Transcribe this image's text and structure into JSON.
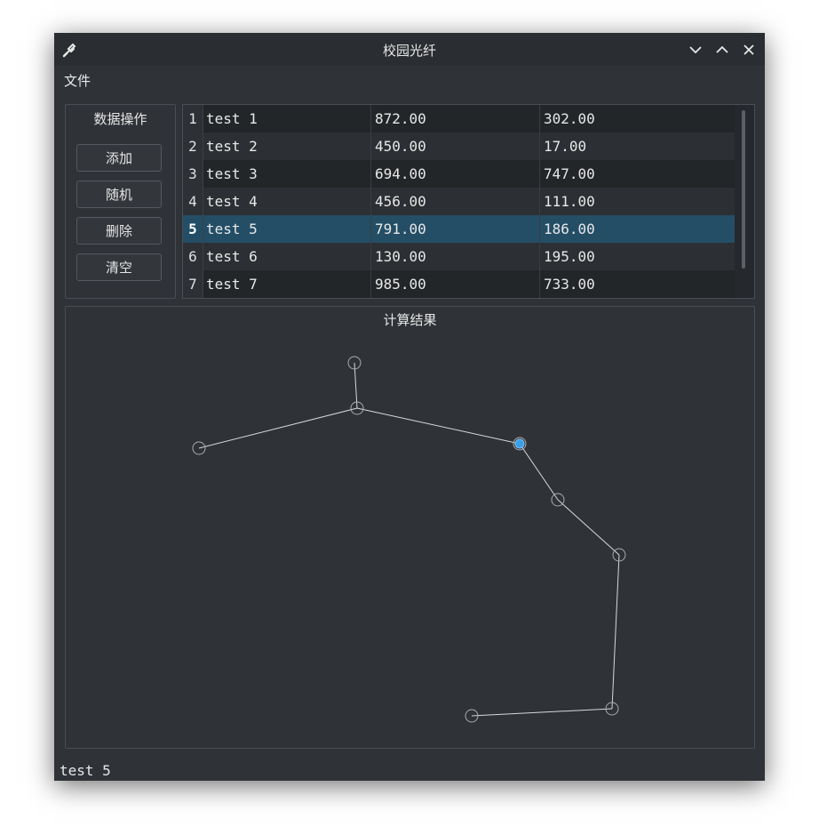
{
  "window": {
    "title": "校园光纤"
  },
  "menu": {
    "file": "文件"
  },
  "ops": {
    "title": "数据操作",
    "buttons": {
      "add": "添加",
      "random": "随机",
      "delete": "删除",
      "clear": "清空"
    }
  },
  "table": {
    "selected_row": 5,
    "rows": [
      {
        "index": "1",
        "name": "test 1",
        "x": "872.00",
        "y": "302.00"
      },
      {
        "index": "2",
        "name": "test 2",
        "x": "450.00",
        "y": "17.00"
      },
      {
        "index": "3",
        "name": "test 3",
        "x": "694.00",
        "y": "747.00"
      },
      {
        "index": "4",
        "name": "test 4",
        "x": "456.00",
        "y": "111.00"
      },
      {
        "index": "5",
        "name": "test 5",
        "x": "791.00",
        "y": "186.00"
      },
      {
        "index": "6",
        "name": "test 6",
        "x": "130.00",
        "y": "195.00"
      },
      {
        "index": "7",
        "name": "test 7",
        "x": "985.00",
        "y": "733.00"
      }
    ]
  },
  "result": {
    "title": "计算结果"
  },
  "status": {
    "text": "test 5"
  },
  "colors": {
    "selection": "#234e66",
    "highlight_node": "#3a9ee8",
    "edge": "#d8d8d8"
  }
}
